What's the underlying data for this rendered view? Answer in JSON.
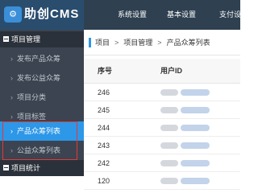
{
  "app": {
    "logo_text": "助创CMS",
    "logo_icon": "logo-icon",
    "logo_icon_glyph": "⚙"
  },
  "top_nav": [
    {
      "label": "系统设置"
    },
    {
      "label": "基本设置"
    },
    {
      "label": "支付设"
    }
  ],
  "sidebar": {
    "section_project": "项目管理",
    "items": [
      {
        "label": "发布产品众筹",
        "icon": "chevron-right-icon"
      },
      {
        "label": "发布公益众筹",
        "icon": "chevron-right-icon"
      },
      {
        "label": "项目分类",
        "icon": "chevron-right-icon"
      },
      {
        "label": "项目标签",
        "icon": "chevron-right-icon"
      },
      {
        "label": "产品众筹列表",
        "icon": "chevron-right-icon",
        "active": true
      },
      {
        "label": "公益众筹列表",
        "icon": "chevron-right-icon"
      }
    ],
    "section_stats": "项目统计",
    "chevron_glyph": "›"
  },
  "breadcrumb": {
    "items": [
      "项目",
      "项目管理",
      "产品众筹列表"
    ],
    "separator": ">"
  },
  "table": {
    "headers": [
      "序号",
      "用户ID"
    ],
    "rows": [
      {
        "id": "246"
      },
      {
        "id": "245"
      },
      {
        "id": "244"
      },
      {
        "id": "243"
      },
      {
        "id": "242"
      },
      {
        "id": "120"
      }
    ]
  },
  "colors": {
    "topbar": "#2f4050",
    "sidebar": "#3b4450",
    "active_item": "#2d97e8",
    "highlight_border": "#e23a3a"
  }
}
